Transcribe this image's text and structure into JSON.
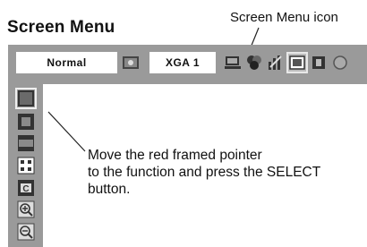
{
  "title": "Screen Menu",
  "callout": "Screen Menu icon",
  "menubar": {
    "mode_label": "Normal",
    "input_label": "XGA 1",
    "icons": [
      "image-select-icon",
      "pc-adjust-icon",
      "color-adjust-icon",
      "image-adjust-icon",
      "screen-icon",
      "sound-icon",
      "setting-icon"
    ]
  },
  "sidebar": {
    "icons": [
      "normal-screen-icon",
      "true-screen-icon",
      "wide-screen-icon",
      "full-screen-icon",
      "custom-screen-icon",
      "digital-zoom-plus-icon",
      "digital-zoom-minus-icon"
    ]
  },
  "instruction": {
    "line1": "Move the red framed pointer",
    "line2": "to the function and press the SELECT button."
  }
}
